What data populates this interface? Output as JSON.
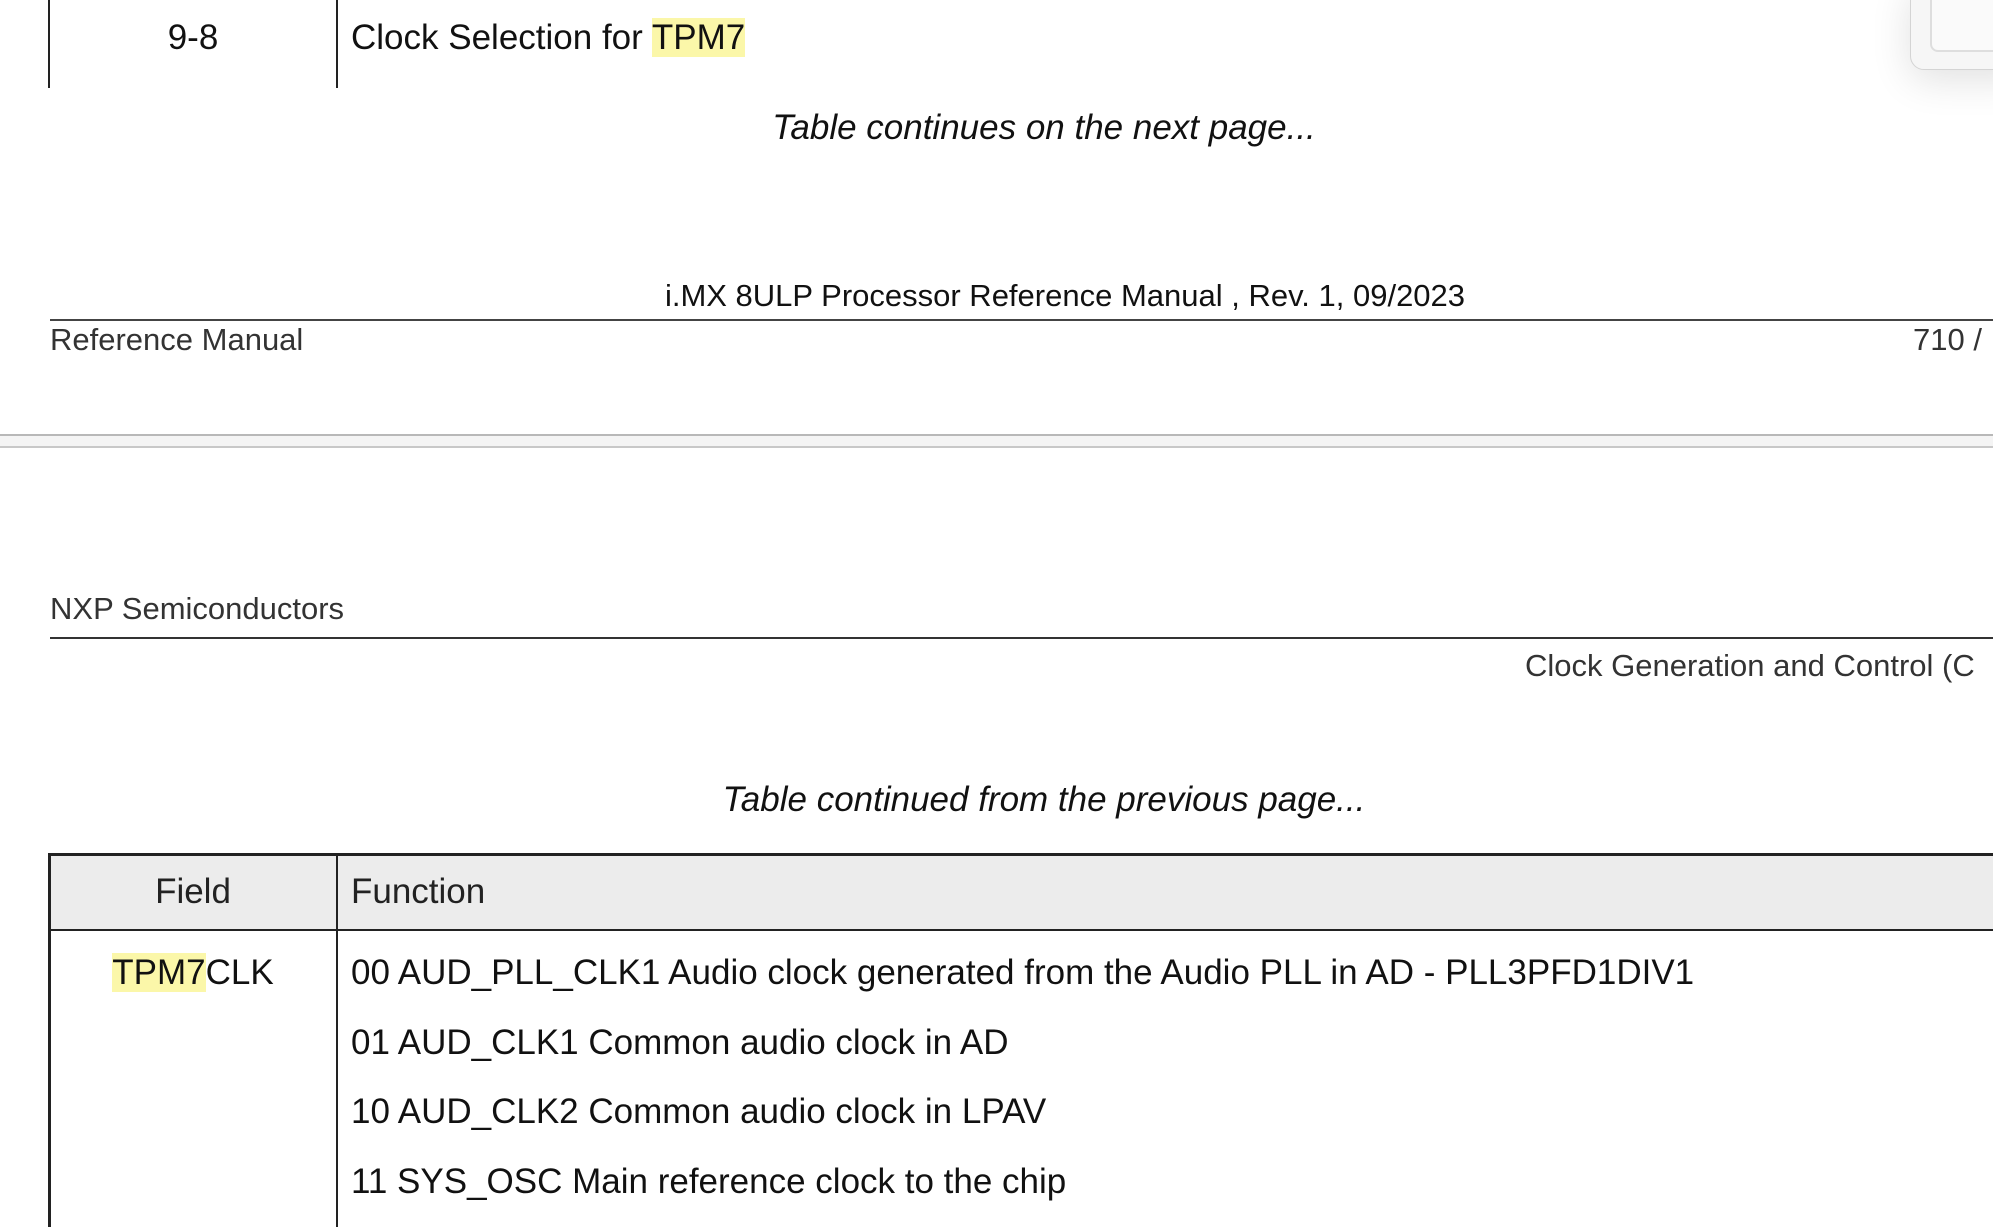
{
  "previous_page": {
    "last_row": {
      "field": "9-8",
      "function_prefix": "Clock Selection for ",
      "function_highlight": "TPM7"
    },
    "continues_note": "Table continues on the next page...",
    "footer": {
      "title": "i.MX 8ULP Processor Reference Manual , Rev. 1, 09/2023",
      "left": "Reference Manual",
      "page_number": "710 /"
    }
  },
  "next_page": {
    "header": {
      "company": "NXP Semiconductors",
      "chapter": "Clock Generation and Control (C"
    },
    "continued_note": "Table continued from the previous page...",
    "table": {
      "columns": [
        "Field",
        "Function"
      ],
      "row": {
        "field_highlight": "TPM7",
        "field_rest": "CLK",
        "function_lines": [
          "00 AUD_PLL_CLK1 Audio clock generated from the Audio PLL in AD - PLL3PFD1DIV1",
          "01 AUD_CLK1 Common audio clock in AD",
          "10 AUD_CLK2 Common audio clock in LPAV",
          "11 SYS_OSC Main reference clock to the chip"
        ]
      }
    }
  },
  "colors": {
    "highlight": "#fbf7a9",
    "table_header_bg": "#ececec",
    "rule": "#222222"
  }
}
